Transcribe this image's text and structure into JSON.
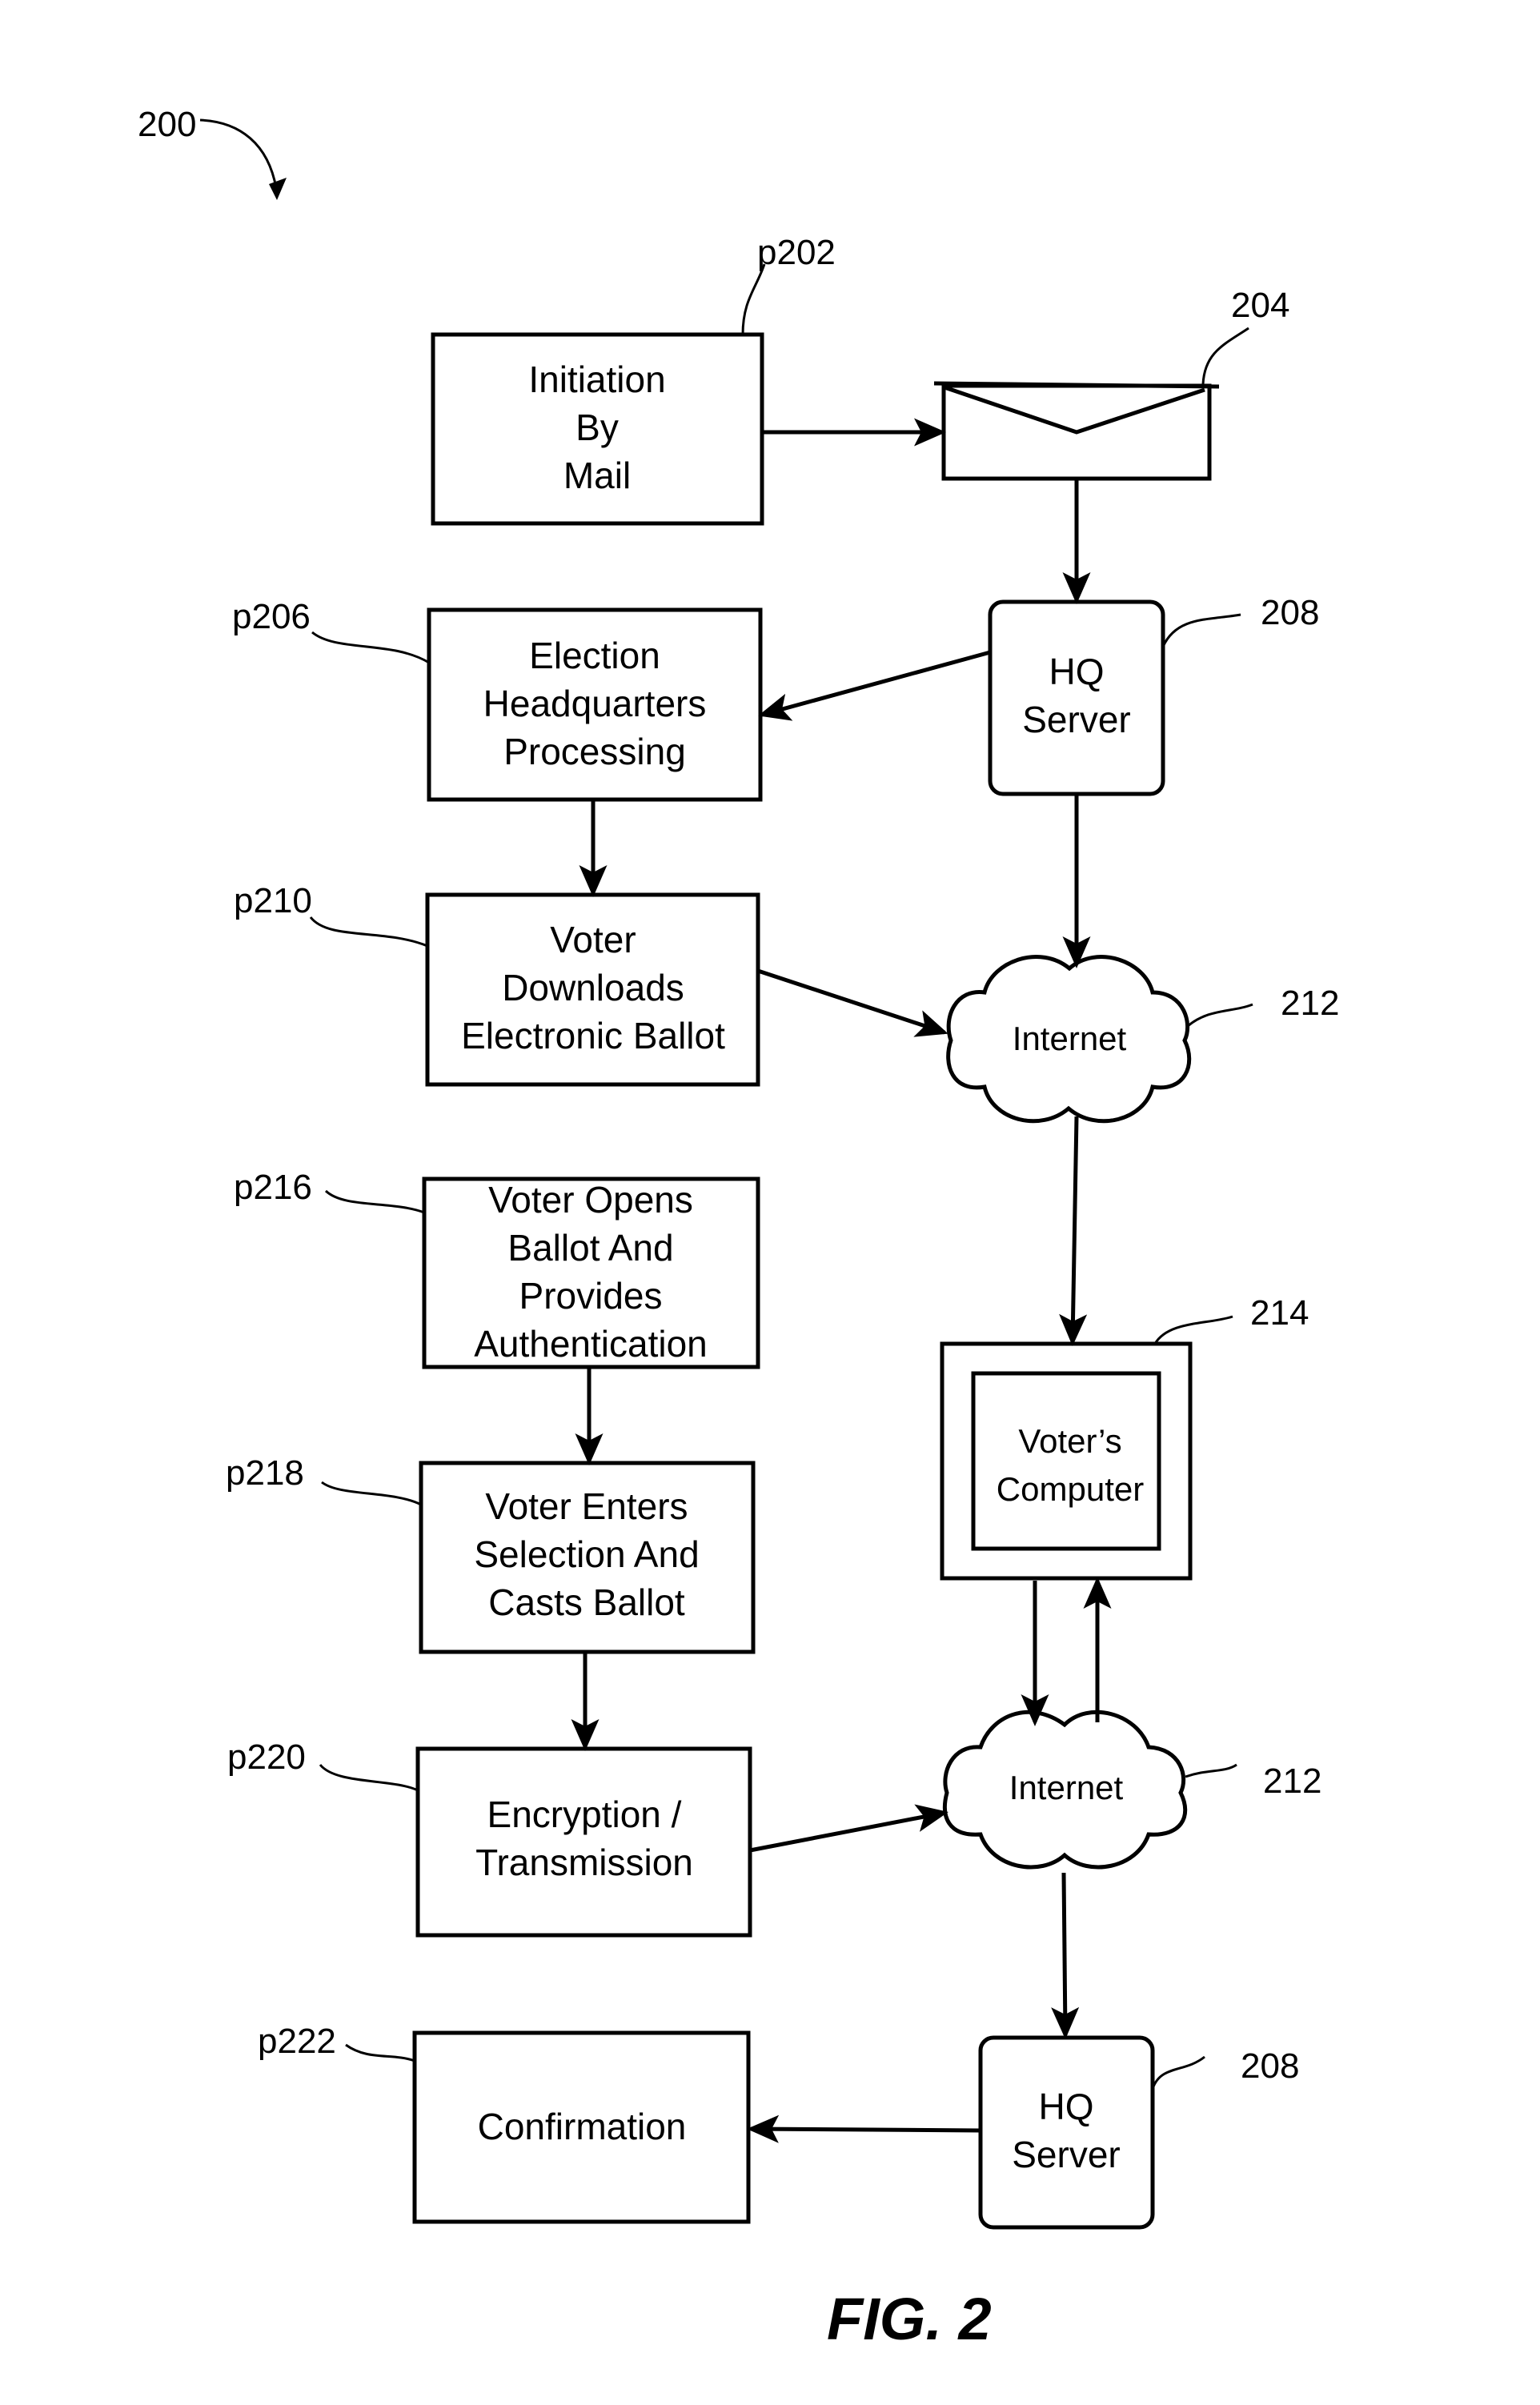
{
  "figure": {
    "number_label": "200",
    "caption": "FIG. 2"
  },
  "steps": [
    {
      "ref": "p202",
      "lines": [
        "Initiation",
        "By",
        "Mail"
      ]
    },
    {
      "ref": "p206",
      "lines": [
        "Election",
        "Headquarters",
        "Processing"
      ]
    },
    {
      "ref": "p210",
      "lines": [
        "Voter",
        "Downloads",
        "Electronic Ballot"
      ]
    },
    {
      "ref": "p216",
      "lines": [
        "Voter Opens",
        "Ballot And",
        "Provides",
        "Authentication"
      ]
    },
    {
      "ref": "p218",
      "lines": [
        "Voter Enters",
        "Selection And",
        "Casts Ballot"
      ]
    },
    {
      "ref": "p220",
      "lines": [
        "Encryption /",
        "Transmission"
      ]
    },
    {
      "ref": "p222",
      "lines": [
        "Confirmation"
      ]
    }
  ],
  "components": {
    "mail": {
      "ref": "204",
      "icon": "envelope-icon"
    },
    "hq_server_top": {
      "ref": "208",
      "lines": [
        "HQ",
        "Server"
      ]
    },
    "internet_top": {
      "ref": "212",
      "label": "Internet"
    },
    "voters_computer": {
      "ref": "214",
      "lines": [
        "Voter’s",
        "Computer"
      ]
    },
    "internet_bottom": {
      "ref": "212",
      "label": "Internet"
    },
    "hq_server_bottom": {
      "ref": "208",
      "lines": [
        "HQ",
        "Server"
      ]
    }
  },
  "connections": [
    {
      "from": "p202",
      "to": "204"
    },
    {
      "from": "204",
      "to": "208-top"
    },
    {
      "from": "208-top",
      "to": "p206"
    },
    {
      "from": "p206",
      "to": "p210"
    },
    {
      "from": "208-top",
      "to": "212-top"
    },
    {
      "from": "p210",
      "to": "212-top"
    },
    {
      "from": "212-top",
      "to": "214"
    },
    {
      "from": "p216",
      "to": "p218"
    },
    {
      "from": "p218",
      "to": "p220"
    },
    {
      "from": "214",
      "to": "212-bottom"
    },
    {
      "from": "212-bottom",
      "to": "214"
    },
    {
      "from": "p220",
      "to": "212-bottom"
    },
    {
      "from": "212-bottom",
      "to": "208-bottom"
    },
    {
      "from": "208-bottom",
      "to": "p222"
    }
  ]
}
